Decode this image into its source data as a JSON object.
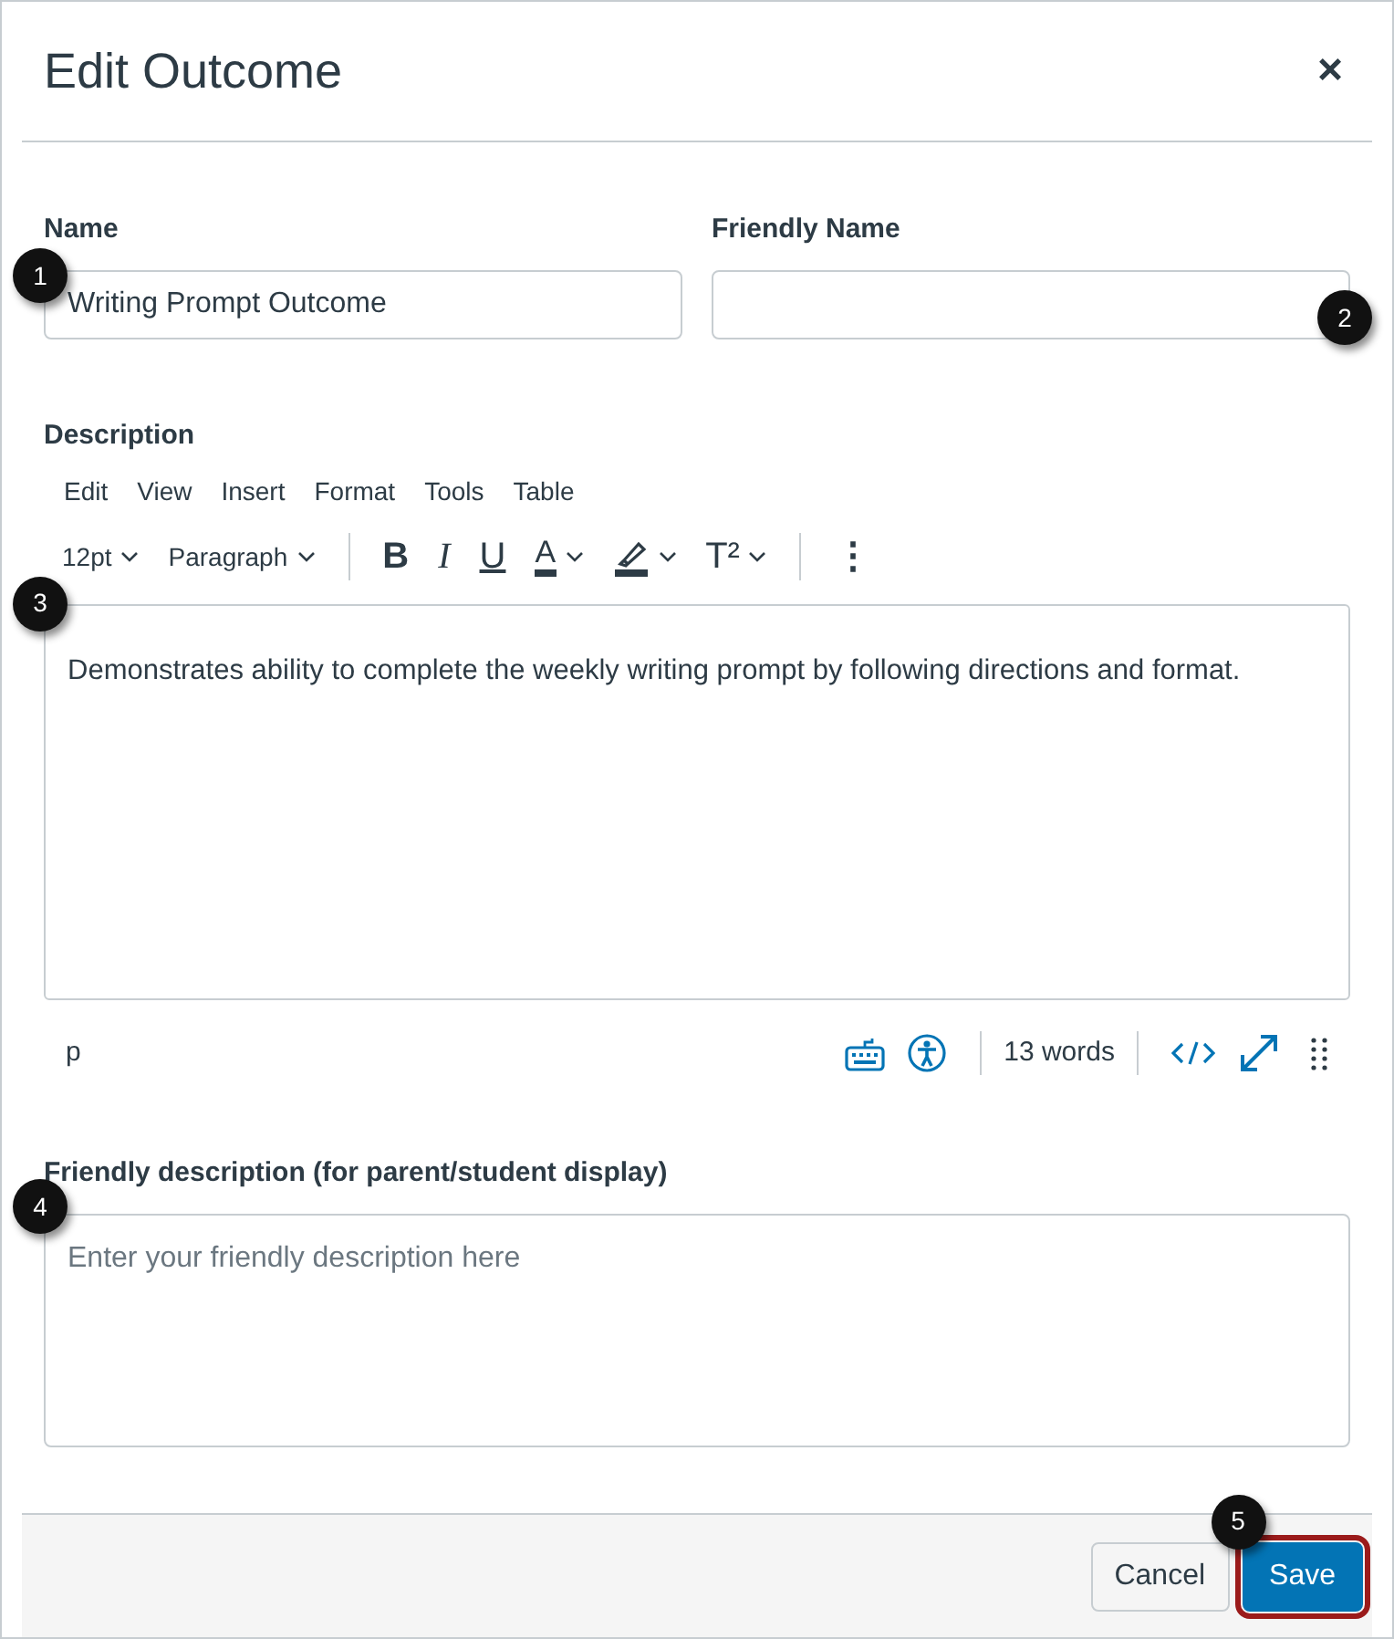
{
  "dialog": {
    "title": "Edit Outcome",
    "close": "×"
  },
  "fields": [
    {
      "label": "Name",
      "value": "Writing Prompt Outcome",
      "callout": "1"
    },
    {
      "label": "Friendly Name",
      "callout": "2"
    }
  ],
  "description": {
    "label": "Description",
    "callout": "3",
    "menu": [
      "Edit",
      "View",
      "Insert",
      "Format",
      "Tools",
      "Table"
    ],
    "toolbar": [
      [
        {
          "kind": "dropdown",
          "label": "12pt"
        },
        {
          "kind": "dropdown",
          "label": "Paragraph"
        }
      ],
      [
        {
          "kind": "bold",
          "label": "B"
        },
        {
          "kind": "italic",
          "label": "I"
        },
        {
          "kind": "underline",
          "label": "U"
        },
        {
          "kind": "text-color",
          "label": "A"
        },
        {
          "kind": "highlight"
        },
        {
          "kind": "superscript",
          "label": "T²"
        }
      ],
      [
        {
          "kind": "more",
          "label": "⋮"
        }
      ]
    ],
    "content": "Demonstrates ability to complete the weekly writing prompt by following directions and format.",
    "status": {
      "element": "p",
      "word_count": "13 words"
    }
  },
  "friendly_description": {
    "label": "Friendly description (for parent/student display)",
    "placeholder": "Enter your friendly description here",
    "callout": "4"
  },
  "buttons": [
    {
      "label": "Cancel",
      "kind": "secondary",
      "highlighted": false
    },
    {
      "label": "Save",
      "kind": "primary",
      "highlighted": true,
      "callout": "5"
    }
  ]
}
